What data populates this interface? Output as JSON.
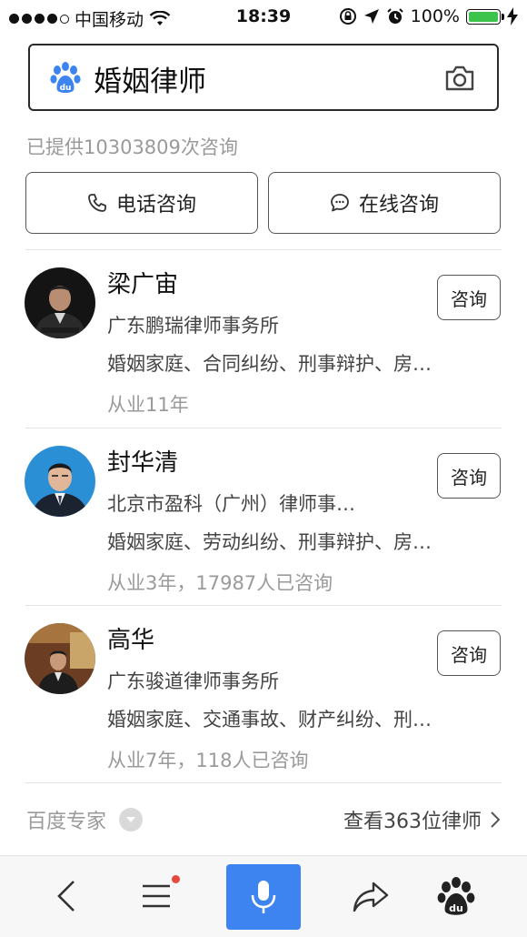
{
  "status_bar": {
    "carrier": "中国移动",
    "time": "18:39",
    "battery": "100%"
  },
  "search": {
    "query": "婚姻律师"
  },
  "served_text": "已提供10303809次咨询",
  "actions": {
    "phone_label": "电话咨询",
    "online_label": "在线咨询"
  },
  "lawyers": [
    {
      "name": "梁广宙",
      "firm": "广东鹏瑞律师事务所",
      "tags": "婚姻家庭、合同纠纷、刑事辩护、房…",
      "experience": "从业11年",
      "consult_label": "咨询"
    },
    {
      "name": "封华清",
      "firm": "北京市盈科（广州）律师事…",
      "tags": "婚姻家庭、劳动纠纷、刑事辩护、房…",
      "experience": "从业3年，17987人已咨询",
      "consult_label": "咨询"
    },
    {
      "name": "高华",
      "firm": "广东骏道律师事务所",
      "tags": "婚姻家庭、交通事故、财产纠纷、刑…",
      "experience": "从业7年，118人已咨询",
      "consult_label": "咨询"
    }
  ],
  "footer": {
    "source_label": "百度专家",
    "view_all_label": "查看363位律师"
  },
  "colors": {
    "brand_blue": "#3e84f1",
    "battery_green": "#3bc34c",
    "notification_red": "#e8473b"
  }
}
